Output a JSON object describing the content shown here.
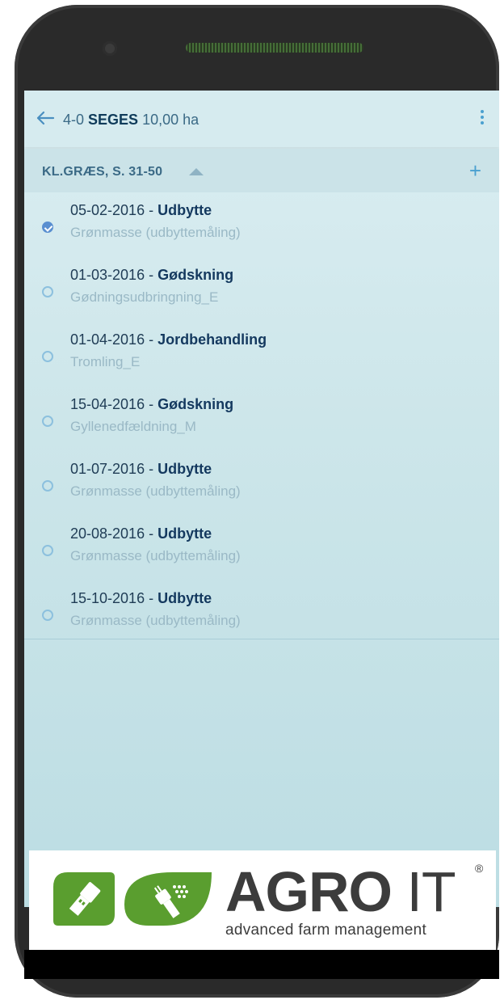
{
  "appbar": {
    "field_id": "4-0",
    "owner": "SEGES",
    "area": "10,00 ha"
  },
  "section": {
    "label": "KL.GRÆS, S. 31-50"
  },
  "items": [
    {
      "date": "05-02-2016",
      "type": "Udbytte",
      "subtitle": "Grønmasse (udbyttemåling)",
      "checked": true
    },
    {
      "date": "01-03-2016",
      "type": "Gødskning",
      "subtitle": "Gødningsudbringning_E",
      "checked": false
    },
    {
      "date": "01-04-2016",
      "type": "Jordbehandling",
      "subtitle": "Tromling_E",
      "checked": false
    },
    {
      "date": "15-04-2016",
      "type": "Gødskning",
      "subtitle": "Gyllenedfældning_M",
      "checked": false
    },
    {
      "date": "01-07-2016",
      "type": "Udbytte",
      "subtitle": "Grønmasse (udbyttemåling)",
      "checked": false
    },
    {
      "date": "20-08-2016",
      "type": "Udbytte",
      "subtitle": "Grønmasse (udbyttemåling)",
      "checked": false
    },
    {
      "date": "15-10-2016",
      "type": "Udbytte",
      "subtitle": "Grønmasse (udbyttemåling)",
      "checked": false
    }
  ],
  "separator": " - ",
  "logo": {
    "text_bold": "AGRO",
    "text_light": " IT",
    "registered": "®",
    "tagline": "advanced farm management",
    "brand_green": "#5a9e2f",
    "text_color": "#3c3c3c"
  },
  "colors": {
    "accent": "#4aa0d0",
    "check": "#5a8fd0"
  }
}
